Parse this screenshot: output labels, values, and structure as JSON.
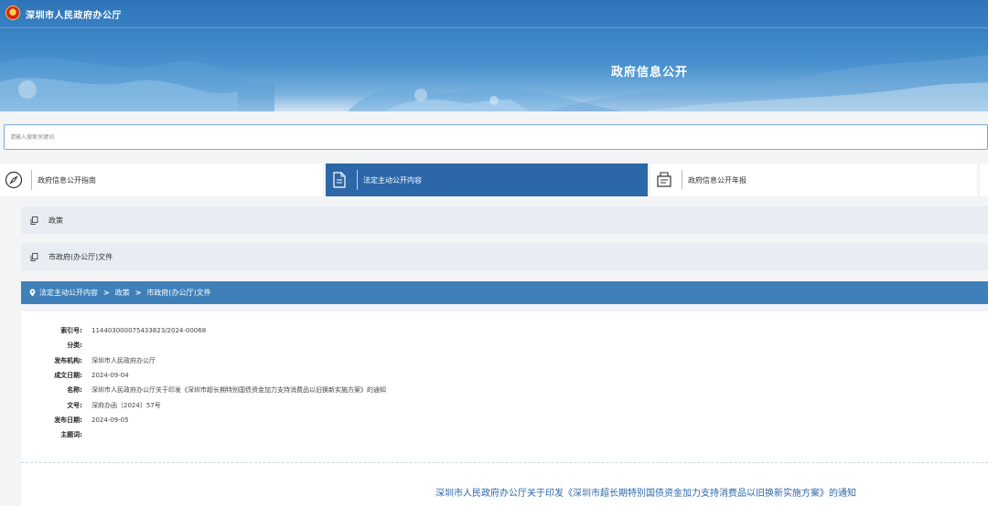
{
  "header": {
    "site_name": "深圳市人民政府办公厅",
    "section_title": "政府信息公开"
  },
  "search": {
    "placeholder": "请输入搜索关键词"
  },
  "tabs": [
    {
      "label": "政府信息公开指南",
      "icon": "compass-icon",
      "active": false
    },
    {
      "label": "法定主动公开内容",
      "icon": "document-icon",
      "active": true
    },
    {
      "label": "政府信息公开年报",
      "icon": "report-icon",
      "active": false
    }
  ],
  "categories": [
    {
      "label": "政策",
      "icon": "copy-icon"
    },
    {
      "label": "市政府(办公厅)文件",
      "icon": "copy-icon"
    }
  ],
  "breadcrumb": {
    "items": [
      "法定主动公开内容",
      "政策",
      "市政府(办公厅)文件"
    ],
    "separator": ">"
  },
  "meta": [
    {
      "key": "索引号:",
      "value": "11440300007543382З/2024-00068"
    },
    {
      "key": "分类:",
      "value": ""
    },
    {
      "key": "发布机构:",
      "value": "深圳市人民政府办公厅"
    },
    {
      "key": "成文日期:",
      "value": "2024-09-04"
    },
    {
      "key": "名称:",
      "value": "深圳市人民政府办公厅关于印发《深圳市超长期特别国债资金加力支持消费品以旧换新实施方案》的通知"
    },
    {
      "key": "文号:",
      "value": "深府办函〔2024〕57号"
    },
    {
      "key": "发布日期:",
      "value": "2024-09-05"
    },
    {
      "key": "主题词:",
      "value": ""
    }
  ],
  "document": {
    "title": "深圳市人民政府办公厅关于印发《深圳市超长期特别国债资金加力支持消费品以旧换新实施方案》的通知"
  },
  "colors": {
    "primary": "#2c67a8",
    "breadcrumb_bg": "#3f80ba",
    "category_bg": "#e7edf3",
    "page_bg": "#f3f4f6"
  }
}
